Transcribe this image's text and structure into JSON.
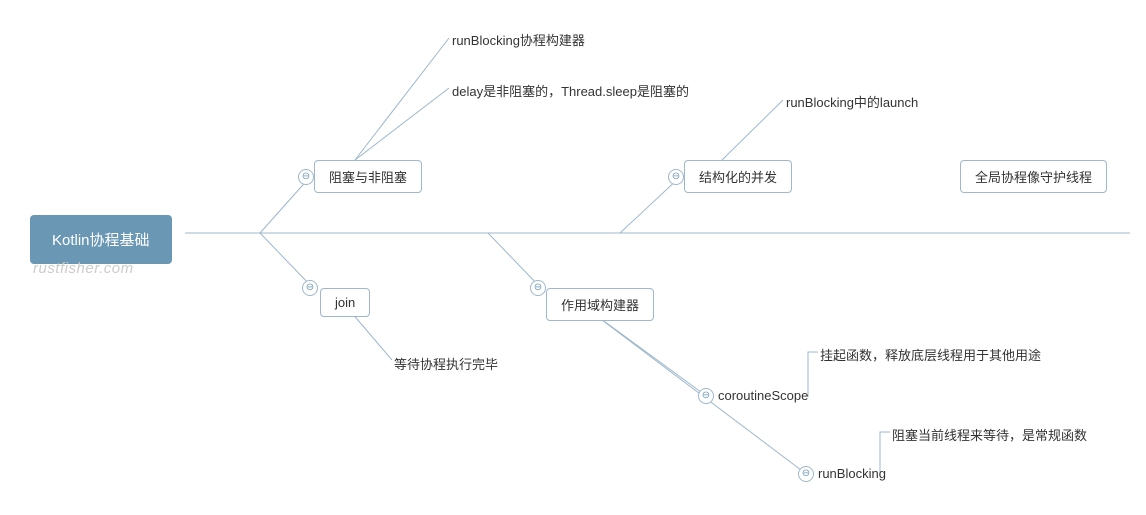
{
  "root": {
    "label": "Kotlin协程基础"
  },
  "watermark": "rustfisher.com",
  "branches": {
    "blocking": {
      "label": "阻塞与非阻塞",
      "children": [
        {
          "label": "runBlocking协程构建器"
        },
        {
          "label": "delay是非阻塞的，Thread.sleep是阻塞的"
        }
      ]
    },
    "join": {
      "label": "join",
      "children": [
        {
          "label": "等待协程执行完毕"
        }
      ]
    },
    "structured": {
      "label": "结构化的并发",
      "children": [
        {
          "label": "runBlocking中的launch"
        }
      ]
    },
    "scope": {
      "label": "作用域构建器",
      "children": [
        {
          "label": "coroutineScope",
          "note": "挂起函数，释放底层线程用于其他用途"
        },
        {
          "label": "runBlocking",
          "note": "阻塞当前线程来等待，是常规函数"
        }
      ]
    },
    "daemon": {
      "label": "全局协程像守护线程"
    }
  },
  "glyph": {
    "collapse": "⊖"
  }
}
